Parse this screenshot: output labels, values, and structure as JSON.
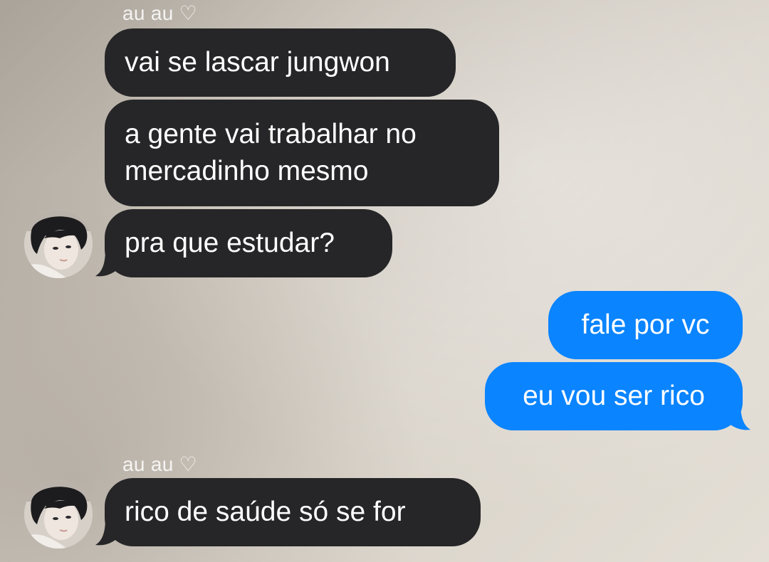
{
  "chat": {
    "sender_name_1": "au au ♡",
    "sender_name_2": "au au ♡",
    "messages": [
      {
        "from": "them",
        "text": "vai se lascar jungwon"
      },
      {
        "from": "them",
        "text": "a gente vai trabalhar no mercadinho mesmo"
      },
      {
        "from": "them",
        "text": "pra que estudar?"
      },
      {
        "from": "me",
        "text": "fale por vc"
      },
      {
        "from": "me",
        "text": "eu vou ser rico"
      },
      {
        "from": "them",
        "text": "rico de saúde só se for"
      }
    ]
  },
  "colors": {
    "incoming_bubble": "#262628",
    "outgoing_bubble": "#0a84ff",
    "bubble_text": "#ffffff"
  },
  "icons": {
    "contact_avatar": "contact-avatar-photo"
  }
}
